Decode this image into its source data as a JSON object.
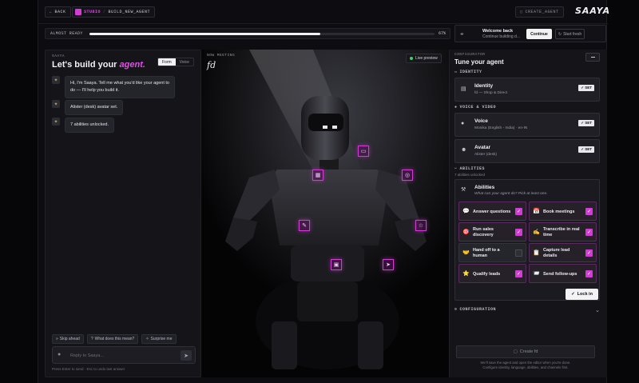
{
  "topbar": {
    "back_label": "BACK",
    "studio_label": "STUDIO",
    "crumb_sep": "/",
    "crumb_label": "BUILD_NEW_AGENT",
    "create_agent_label": "CREATE_AGENT",
    "logo_text": "SAAYA"
  },
  "progress": {
    "label": "ALMOST READY",
    "percent": 67,
    "percent_text": "67%"
  },
  "welcome": {
    "title": "Welcome back",
    "subtitle": "Continue building d...",
    "continue_label": "Continue",
    "start_fresh_label": "Start fresh"
  },
  "left": {
    "kicker": "SAAYA",
    "heading_prefix": "Let's build your",
    "heading_accent": "agent.",
    "tabs": [
      {
        "label": "Form"
      },
      {
        "label": "Voice"
      }
    ],
    "messages": [
      {
        "text_line1": "Hi, I'm Saaya. Tell me what you'd like your agent to",
        "text_line2": "do — I'll help you build it."
      },
      {
        "text_line1": "Alister (desk) avatar set."
      },
      {
        "text_line1": "7 abilities unlocked."
      }
    ],
    "chips": [
      {
        "label": "Skip ahead"
      },
      {
        "label": "What does this mean?"
      },
      {
        "label": "Surprise me"
      }
    ],
    "reply_placeholder": "Reply to Saaya...",
    "hint": "Press  Enter  to send ·  Esc  to undo last answer"
  },
  "stage": {
    "kicker": "NOW MEETING",
    "agent_name": "fd",
    "live_label": "Live preview"
  },
  "right": {
    "kicker": "CONFIGURATOR",
    "title": "Tune your agent",
    "sections": {
      "identity": "IDENTITY",
      "voice_video": "VOICE & VIDEO",
      "abilities": "ABILITIES",
      "abilities_sub": "7 abilities unlocked",
      "configuration": "CONFIGURATION"
    },
    "cards": [
      {
        "title": "Identity",
        "sub": "fd — Shop & Direct",
        "set": "SET"
      },
      {
        "title": "Voice",
        "sub": "Monika (English - India) · en-IN",
        "set": "SET"
      },
      {
        "title": "Avatar",
        "sub": "Alister (desk)",
        "set": "SET"
      }
    ],
    "abilities_card": {
      "title": "Abilities",
      "sub": "What can your agent do? Pick at least one."
    },
    "abilities": [
      {
        "label": "Answer questions",
        "checked": true
      },
      {
        "label": "Book meetings",
        "checked": true
      },
      {
        "label": "Run sales discovery",
        "checked": true
      },
      {
        "label": "Transcribe in real time",
        "checked": true
      },
      {
        "label": "Hand off to a human",
        "checked": false
      },
      {
        "label": "Capture lead details",
        "checked": true
      },
      {
        "label": "Qualify leads",
        "checked": true
      },
      {
        "label": "Send follow-ups",
        "checked": true
      }
    ],
    "lock_in_label": "Lock in",
    "create_label": "Create fd",
    "create_note_line1": "We'll save the agent and open the editor when you're done.",
    "create_note_line2": "Configure identity, language, abilities, and channels first."
  },
  "colors": {
    "accent": "#d43bd6",
    "background": "#0d0d11",
    "live_dot": "#3ad36b"
  }
}
